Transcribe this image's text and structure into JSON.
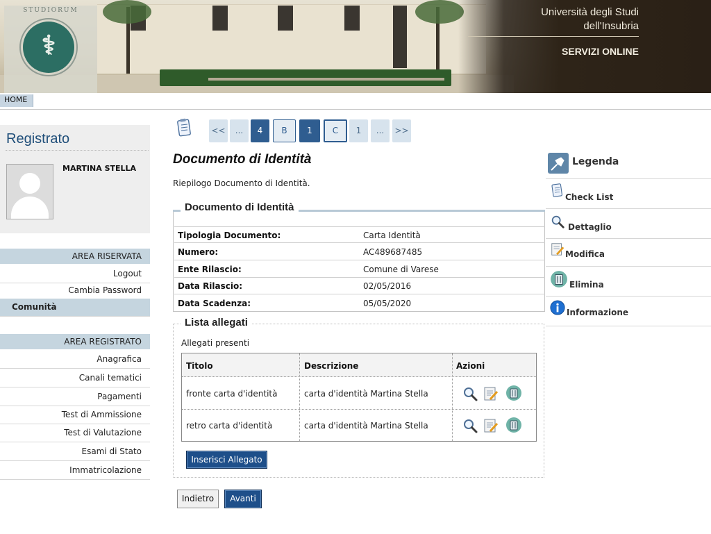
{
  "header": {
    "university_line1": "Università degli Studi",
    "university_line2": "dell'Insubria",
    "services": "SERVIZI ONLINE",
    "logo_motto": "STUDIORUM"
  },
  "nav": {
    "home": "HOME"
  },
  "sidebar": {
    "title": "Registrato",
    "user_name": "MARTINA STELLA",
    "area_riservata": {
      "heading": "AREA RISERVATA",
      "items": [
        {
          "label": "Logout"
        },
        {
          "label": "Cambia Password"
        },
        {
          "label": "Comunità"
        }
      ]
    },
    "area_registrato": {
      "heading": "AREA REGISTRATO",
      "items": [
        {
          "label": "Anagrafica"
        },
        {
          "label": "Canali tematici"
        },
        {
          "label": "Pagamenti"
        },
        {
          "label": "Test di Ammissione"
        },
        {
          "label": "Test di Valutazione"
        },
        {
          "label": "Esami di Stato"
        },
        {
          "label": "Immatricolazione"
        }
      ]
    }
  },
  "pager": {
    "items": [
      "<<",
      "...",
      "4",
      "B",
      "1",
      "C",
      "1",
      "...",
      ">>"
    ]
  },
  "main": {
    "title": "Documento di Identità",
    "subtitle": "Riepilogo Documento di Identità.",
    "doc_section": {
      "legend": "Documento di Identità",
      "rows": [
        {
          "key": "Tipologia Documento:",
          "value": "Carta Identità"
        },
        {
          "key": "Numero:",
          "value": "AC489687485"
        },
        {
          "key": "Ente Rilascio:",
          "value": "Comune di Varese"
        },
        {
          "key": "Data Rilascio:",
          "value": "02/05/2016"
        },
        {
          "key": "Data Scadenza:",
          "value": "05/05/2020"
        }
      ]
    },
    "attachments": {
      "legend": "Lista allegati",
      "present_label": "Allegati presenti",
      "columns": [
        "Titolo",
        "Descrizione",
        "Azioni"
      ],
      "rows": [
        {
          "title": "fronte carta d'identità",
          "description": "carta d'identità Martina Stella"
        },
        {
          "title": "retro carta d'identità",
          "description": "carta d'identità Martina Stella"
        }
      ],
      "insert_button": "Inserisci Allegato"
    },
    "back_button": "Indietro",
    "next_button": "Avanti"
  },
  "legend": {
    "title": "Legenda",
    "items": [
      {
        "label": "Check List",
        "icon": "checklist-icon"
      },
      {
        "label": "Dettaglio",
        "icon": "magnifier-icon"
      },
      {
        "label": "Modifica",
        "icon": "edit-icon"
      },
      {
        "label": "Elimina",
        "icon": "trash-icon"
      },
      {
        "label": "Informazione",
        "icon": "info-icon"
      }
    ]
  },
  "colors": {
    "primary": "#1e4f8a",
    "sidebar_heading": "#c5d5df",
    "title_blue": "#1f4e79"
  }
}
